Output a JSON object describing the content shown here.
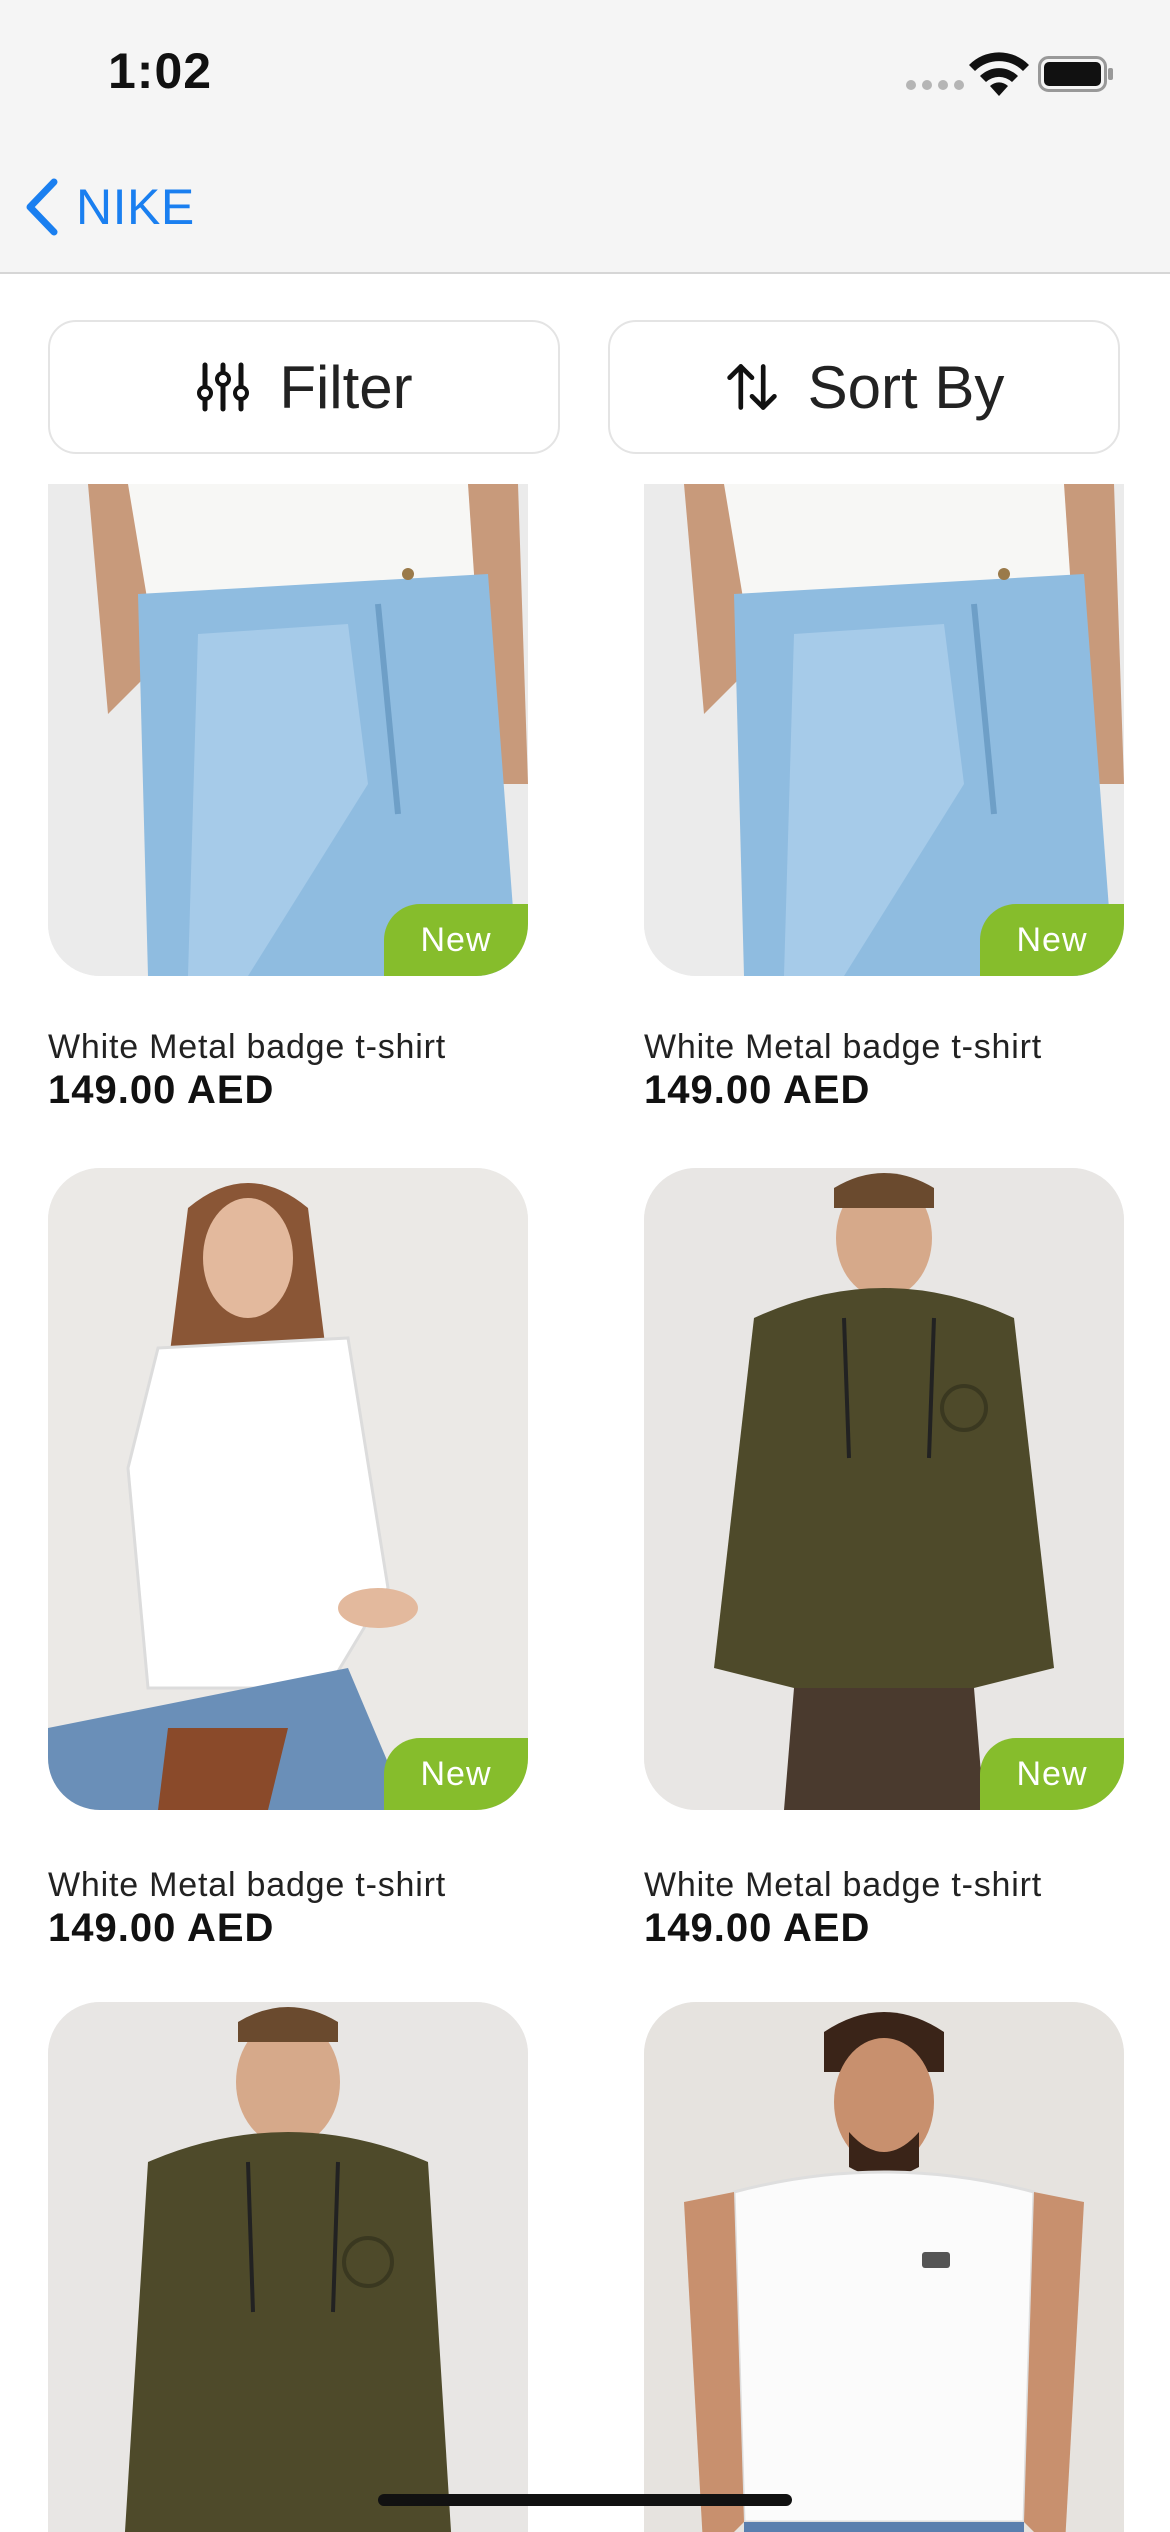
{
  "status_bar": {
    "time": "1:02"
  },
  "nav": {
    "back_label": "NIKE"
  },
  "controls": {
    "filter_label": "Filter",
    "sort_label": "Sort By"
  },
  "products": [
    {
      "name": "White Metal badge t-shirt",
      "price": "149.00 AED",
      "badge": "New",
      "image": "jeans-photo"
    },
    {
      "name": "White Metal badge t-shirt",
      "price": "149.00 AED",
      "badge": "New",
      "image": "jeans-photo"
    },
    {
      "name": "White Metal badge t-shirt",
      "price": "149.00 AED",
      "badge": "New",
      "image": "white-blouse-photo"
    },
    {
      "name": "White Metal badge t-shirt",
      "price": "149.00 AED",
      "badge": "New",
      "image": "olive-hoodie-photo"
    },
    {
      "image": "olive-hoodie-photo"
    },
    {
      "image": "white-tshirt-photo"
    }
  ],
  "colors": {
    "accent": "#1a7ff0",
    "badge": "#86bd2c"
  }
}
